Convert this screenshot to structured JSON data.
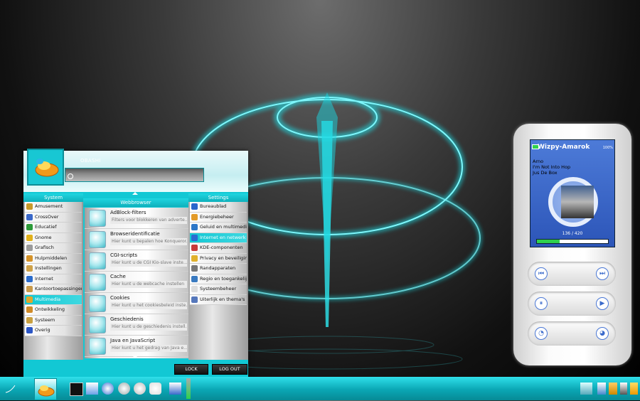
{
  "menu": {
    "username": "OBASHI",
    "search_placeholder": "",
    "col_system": "System",
    "col_webbrowser": "Webbrowser",
    "col_settings": "Settings",
    "system_items": [
      {
        "label": "Amusement",
        "color": "#c89a2a"
      },
      {
        "label": "CrossOver",
        "color": "#3a68c9"
      },
      {
        "label": "Educatief",
        "color": "#2d9b3a"
      },
      {
        "label": "Gnome",
        "color": "#e1b11c"
      },
      {
        "label": "Grafisch",
        "color": "#9b9b9b"
      },
      {
        "label": "Hulpmiddelen",
        "color": "#d5932a"
      },
      {
        "label": "Instellingen",
        "color": "#cfa24a"
      },
      {
        "label": "Internet",
        "color": "#2b6ccc"
      },
      {
        "label": "Kantoortoepassingen",
        "color": "#c99a4a"
      },
      {
        "label": "Multimedia",
        "color": "#e0a72c"
      },
      {
        "label": "Ontwikkeling",
        "color": "#d08b28"
      },
      {
        "label": "Systeem",
        "color": "#c9a040"
      },
      {
        "label": "Overig",
        "color": "#2a55c5"
      }
    ],
    "system_selected": 9,
    "web_items": [
      {
        "title": "AdBlock-filters",
        "desc": "Filters voor blokkeren van adverte..."
      },
      {
        "title": "Browseridentificatie",
        "desc": "Hier kunt u bepalen hoe Konqueror..."
      },
      {
        "title": "CGI-scripts",
        "desc": "Hier kunt u de CGI Kio-slave inste..."
      },
      {
        "title": "Cache",
        "desc": "Hier kunt u de webcache instellen"
      },
      {
        "title": "Cookies",
        "desc": "Hier kunt u het cookiesbeleid inste..."
      },
      {
        "title": "Geschiedenis",
        "desc": "Hier kunt u de geschiedenis instell..."
      },
      {
        "title": "Java en JavaScript",
        "desc": "Hier kunt u het gedrag van Java e..."
      }
    ],
    "settings_items": [
      {
        "label": "Bureaublad",
        "color": "#2a66cc"
      },
      {
        "label": "Energiebeheer",
        "color": "#e39b28"
      },
      {
        "label": "Geluid en multimedia",
        "color": "#2d77c7"
      },
      {
        "label": "Internet en netwerk",
        "color": "#2a6bd0"
      },
      {
        "label": "KDE-componenten",
        "color": "#c73a3a"
      },
      {
        "label": "Privacy en beveiliging",
        "color": "#e1b12c"
      },
      {
        "label": "Randapparaten",
        "color": "#777777"
      },
      {
        "label": "Regio en toegankelijk.",
        "color": "#3a7ac0"
      },
      {
        "label": "Systeembeheer",
        "color": "#dddddd"
      },
      {
        "label": "Uiterlijk en thema's",
        "color": "#5577bb"
      }
    ],
    "settings_selected": 3,
    "lock_label": "LOCK",
    "logout_label": "LOG OUT"
  },
  "amarok": {
    "title": "Wizpy-Amarok",
    "volume": "100%",
    "artist": "Arno",
    "song": "I'm Not Into Hop",
    "album": "Jus De Box",
    "time": "136  /  420",
    "progress": 0.324
  },
  "icons": {
    "prev": "skip-back-icon",
    "next": "skip-forward-icon",
    "pause": "pause-icon",
    "play": "play-icon",
    "vol_down": "volume-down-icon",
    "vol_up": "volume-up-icon"
  }
}
